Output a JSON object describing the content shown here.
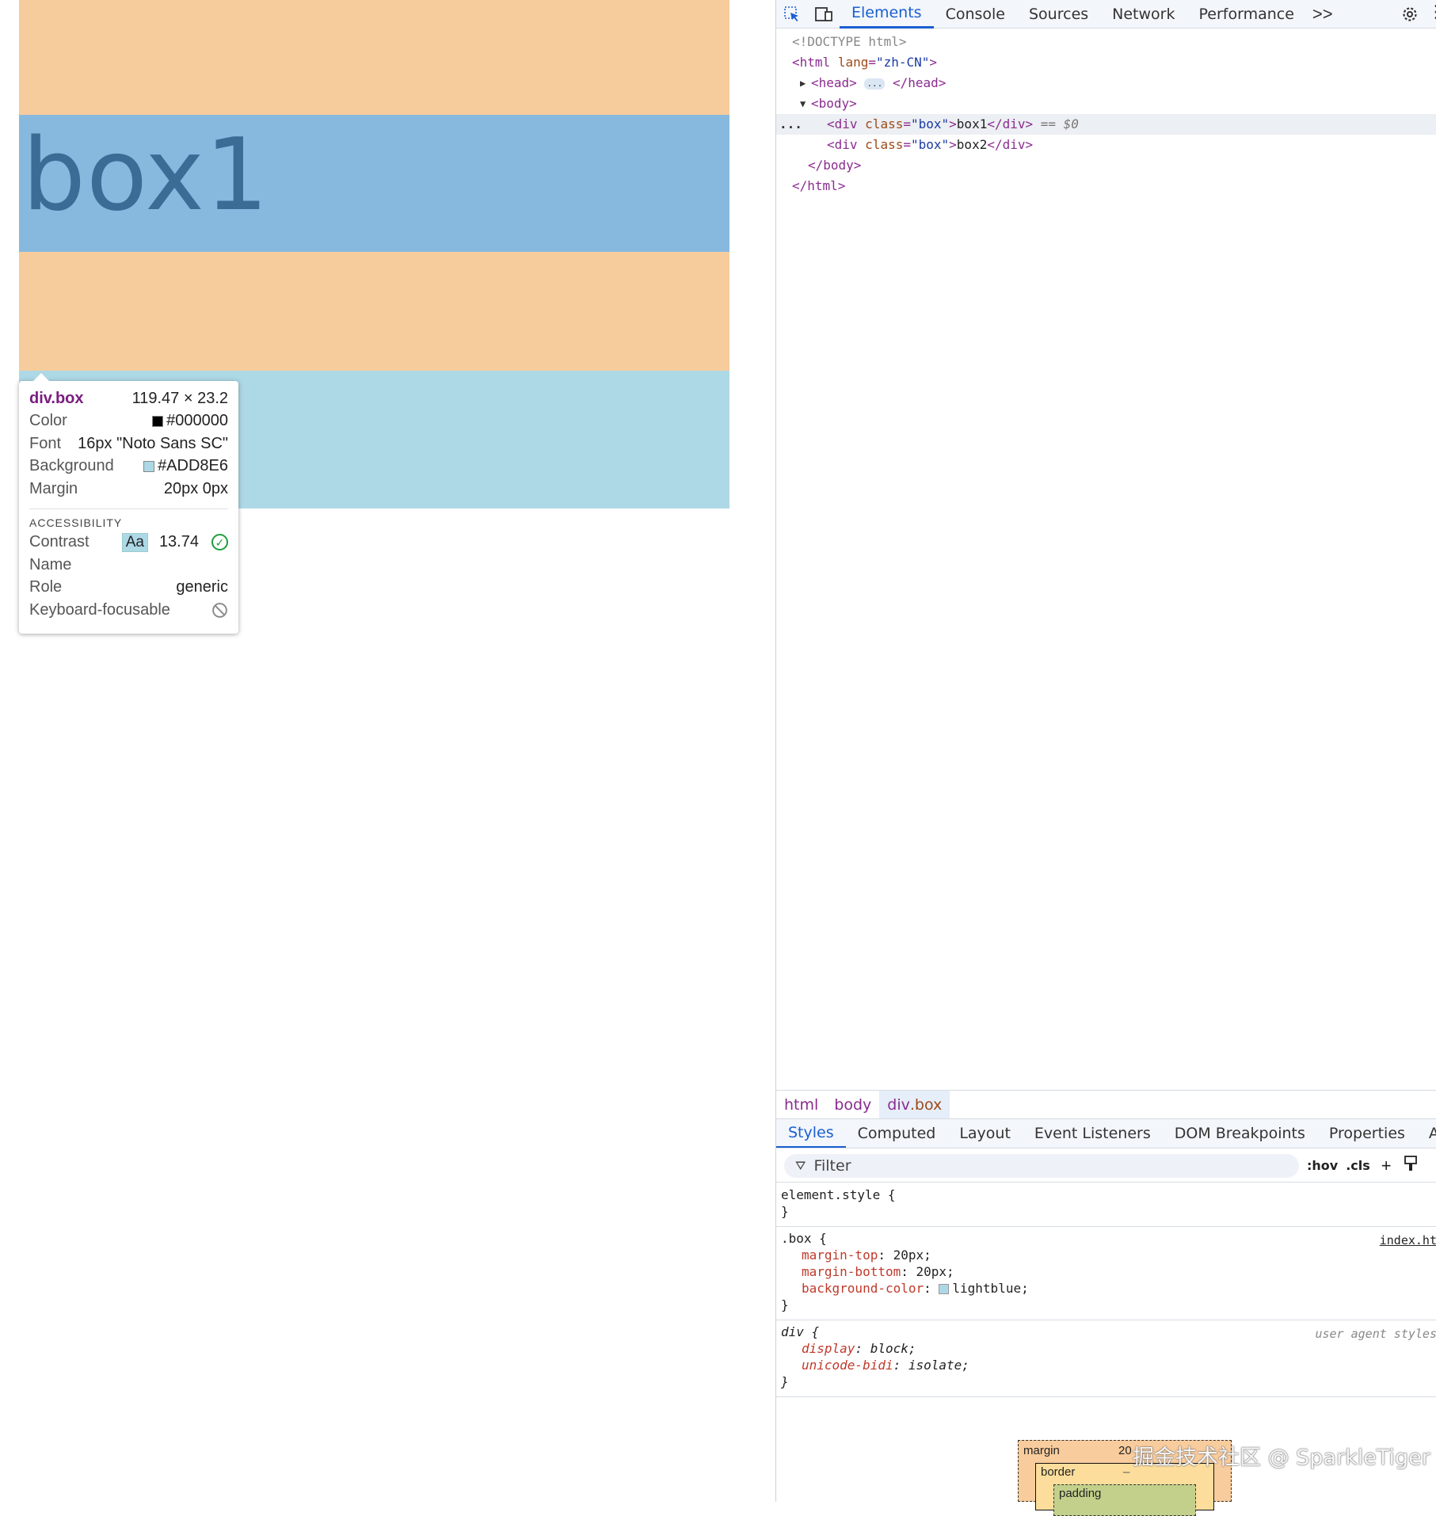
{
  "viewport": {
    "box1_text": "box1",
    "colors": {
      "margin_overlay": "#f6cc9c",
      "content_overlay": "#87b9df",
      "box_background": "#add8e6"
    }
  },
  "tooltip": {
    "element": "div.box",
    "size": "119.47 × 23.2",
    "rows": [
      {
        "key": "Color",
        "value": "#000000",
        "swatch": "#000000"
      },
      {
        "key": "Font",
        "value": "16px \"Noto Sans SC\""
      },
      {
        "key": "Background",
        "value": "#ADD8E6",
        "swatch": "#ADD8E6"
      },
      {
        "key": "Margin",
        "value": "20px 0px"
      }
    ],
    "section": "ACCESSIBILITY",
    "contrast_label": "Contrast",
    "contrast_chip": "Aa",
    "contrast_value": "13.74",
    "name_label": "Name",
    "role_label": "Role",
    "role_value": "generic",
    "focusable_label": "Keyboard-focusable"
  },
  "devtools": {
    "tabs": [
      "Elements",
      "Console",
      "Sources",
      "Network",
      "Performance"
    ],
    "more": ">>",
    "dom": {
      "doctype": "<!DOCTYPE html>",
      "html_open_tag": "<html",
      "html_lang_attr": "lang",
      "html_lang_value": "\"zh-CN\"",
      "head_open": "<head>",
      "head_ellipsis": "...",
      "head_close": "</head>",
      "body_open": "<body>",
      "div_open": "<div",
      "class_attr": "class",
      "class_value": "\"box\"",
      "box1_text": "box1",
      "box2_text": "box2",
      "div_close": "</div>",
      "selected_marker": "== $0",
      "body_close": "</body>",
      "html_close": "</html>",
      "dots": "..."
    },
    "breadcrumb": {
      "html": "html",
      "body": "body",
      "div": "div",
      "div_class": ".box"
    },
    "lower_tabs": [
      "Styles",
      "Computed",
      "Layout",
      "Event Listeners",
      "DOM Breakpoints",
      "Properties",
      "Accessil"
    ],
    "filter": {
      "placeholder": "Filter",
      "hov": ":hov",
      "cls": ".cls"
    },
    "rules": {
      "element_style": "element.style {",
      "close_brace": "}",
      "box_selector": ".box {",
      "box_source": "index.ht",
      "box_props": [
        {
          "name": "margin-top",
          "value": "20px;"
        },
        {
          "name": "margin-bottom",
          "value": "20px;"
        },
        {
          "name": "background-color",
          "value": "lightblue;"
        }
      ],
      "div_selector": "div {",
      "div_source": "user agent styles",
      "div_props": [
        {
          "name": "display",
          "value": "block;"
        },
        {
          "name": "unicode-bidi",
          "value": "isolate;"
        }
      ]
    },
    "box_model": {
      "margin_label": "margin",
      "margin_value": "20",
      "border_label": "border",
      "border_value": "–",
      "padding_label": "padding"
    }
  },
  "watermark": "掘金技术社区 @ SparkleTiger"
}
